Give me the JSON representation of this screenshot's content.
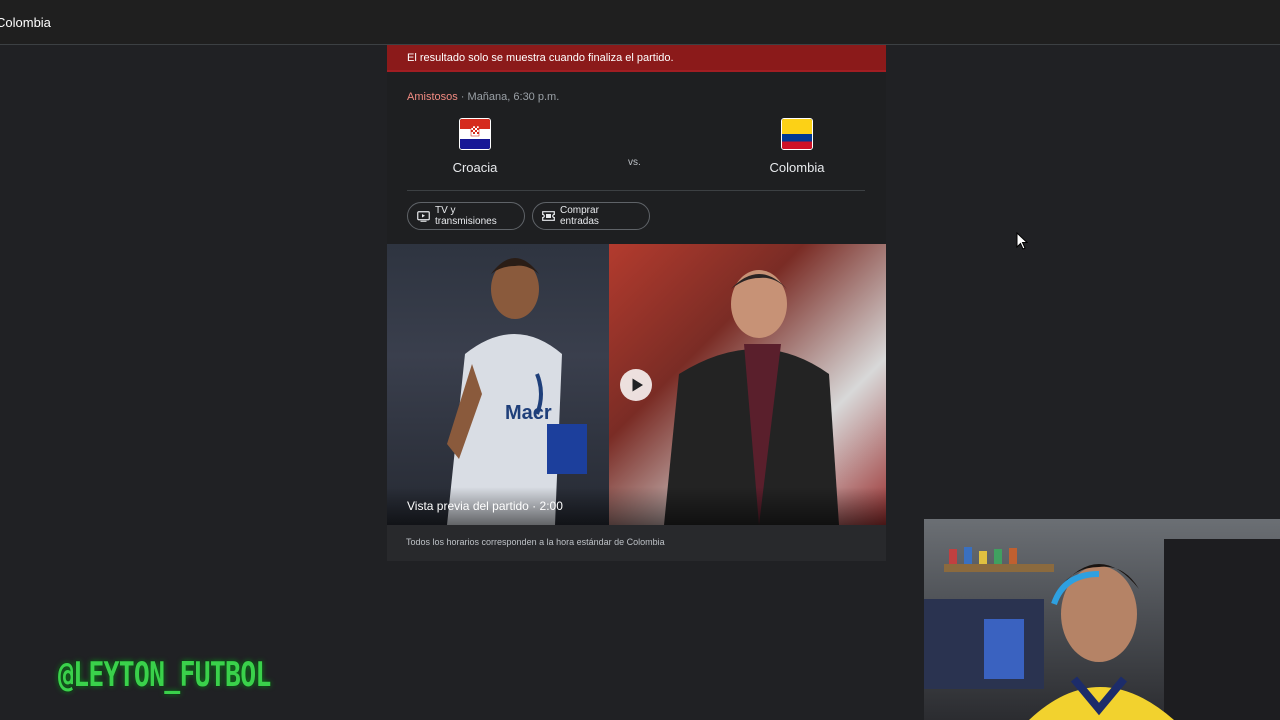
{
  "topbar": {
    "title": "Colombia"
  },
  "banner": {
    "text": "El resultado solo se muestra cuando finaliza el partido."
  },
  "match": {
    "competition": "Amistosos",
    "separator": " · ",
    "datetime": "Mañana, 6:30 p.m.",
    "home": {
      "name": "Croacia"
    },
    "away": {
      "name": "Colombia"
    },
    "vs": "vs."
  },
  "chips": {
    "tv": "TV y transmisiones",
    "tickets": "Comprar entradas"
  },
  "video": {
    "caption": "Vista previa del partido · 2:00"
  },
  "footer": {
    "text": "Todos los horarios corresponden a la hora estándar de Colombia"
  },
  "overlay": {
    "watermark": "@LEYTON_FUTBOL"
  },
  "colors": {
    "background": "#202124",
    "banner": "#8b1a1a",
    "competition": "#f28b82",
    "watermark": "#3ad14b"
  },
  "icons": [
    "tv-icon",
    "ticket-icon",
    "play-icon",
    "cursor-icon",
    "croatia-flag-icon",
    "colombia-flag-icon"
  ]
}
